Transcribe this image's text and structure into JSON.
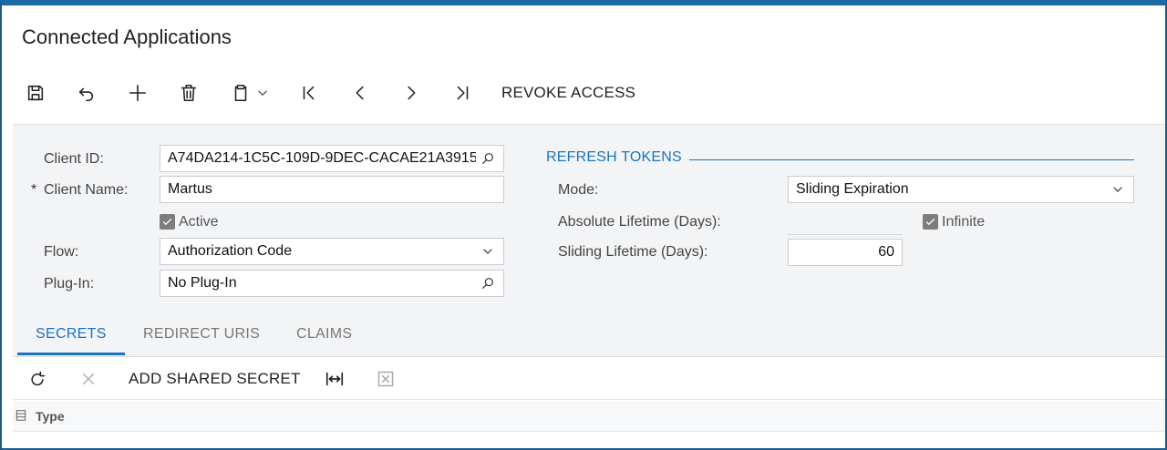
{
  "page": {
    "title": "Connected Applications"
  },
  "toolbar": {
    "save_icon": "save-icon",
    "undo_icon": "undo-icon",
    "add_icon": "plus-icon",
    "delete_icon": "trash-icon",
    "clipboard_icon": "clipboard-icon",
    "first_icon": "first-page-icon",
    "prev_icon": "chevron-left-icon",
    "next_icon": "chevron-right-icon",
    "last_icon": "last-page-icon",
    "revoke_label": "REVOKE ACCESS"
  },
  "form": {
    "client_id_label": "Client ID:",
    "client_id_value": "A74DA214-1C5C-109D-9DEC-CACAE21A3915",
    "client_name_required": "*",
    "client_name_label": "Client Name:",
    "client_name_value": "Martus",
    "active_label": "Active",
    "active_checked": true,
    "flow_label": "Flow:",
    "flow_value": "Authorization Code",
    "plugin_label": "Plug-In:",
    "plugin_value": "No Plug-In"
  },
  "refresh_tokens": {
    "section_title": "REFRESH TOKENS",
    "mode_label": "Mode:",
    "mode_value": "Sliding Expiration",
    "absolute_lifetime_label": "Absolute Lifetime (Days):",
    "infinite_label": "Infinite",
    "infinite_checked": true,
    "sliding_lifetime_label": "Sliding Lifetime (Days):",
    "sliding_lifetime_value": "60"
  },
  "tabs": [
    {
      "label": "SECRETS",
      "active": true
    },
    {
      "label": "REDIRECT URIS",
      "active": false
    },
    {
      "label": "CLAIMS",
      "active": false
    }
  ],
  "grid_toolbar": {
    "refresh_icon": "refresh-icon",
    "remove_icon": "close-icon",
    "add_shared_secret_label": "ADD SHARED SECRET",
    "fit_icon": "fit-columns-icon",
    "excel_icon": "excel-export-icon"
  },
  "grid": {
    "columns": [
      "Type"
    ]
  },
  "colors": {
    "accent": "#1a73c0",
    "frame": "#1f5a86",
    "form_bg": "#f3f4f6"
  }
}
